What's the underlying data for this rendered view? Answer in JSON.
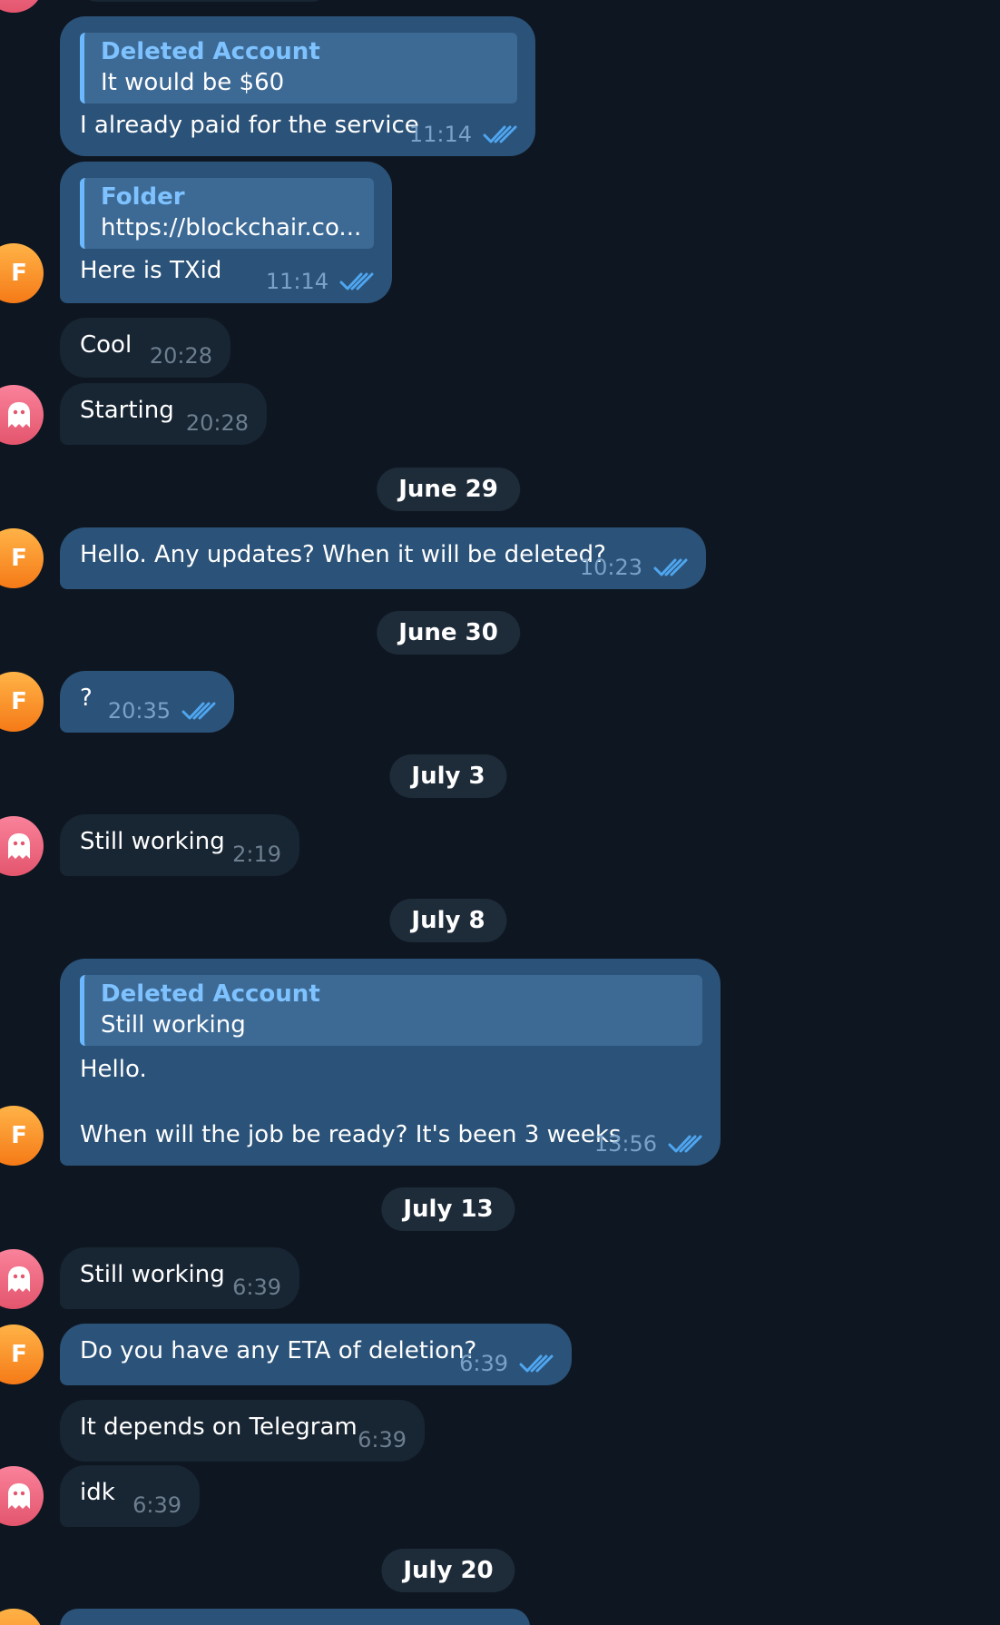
{
  "colors": {
    "background": "#0e1621",
    "outgoing_bubble": "#2b5278",
    "incoming_bubble": "#182533",
    "reply_accent": "#6cb8ff",
    "reply_author": "#7ec2ff",
    "avatar_f": "#f57a17",
    "avatar_ghost": "#e3556d",
    "read_check": "#4fa6f0"
  },
  "avatars": {
    "f_initial": "F",
    "ghost_icon": "ghost-icon"
  },
  "messages": [
    {
      "reply_author": "Deleted Account",
      "reply_text": "It would be $60",
      "text": "I already paid for the service",
      "time": "11:14"
    },
    {
      "reply_author": "Folder",
      "reply_text": "https://blockchair.co...",
      "text": "Here is TXid",
      "time": "11:14"
    },
    {
      "text": "Cool",
      "time": "20:28"
    },
    {
      "text": "Starting",
      "time": "20:28"
    },
    {
      "date": "June 29"
    },
    {
      "text": "Hello. Any updates? When it will be deleted?",
      "time": "10:23"
    },
    {
      "date": "June 30"
    },
    {
      "text": "?",
      "time": "20:35"
    },
    {
      "date": "July 3"
    },
    {
      "text": "Still working",
      "time": "2:19"
    },
    {
      "date": "July 8"
    },
    {
      "reply_author": "Deleted Account",
      "reply_text": "Still working",
      "text_line1": "Hello.",
      "text_line2": "When will the job be ready? It's been 3 weeks",
      "time": "13:56"
    },
    {
      "date": "July 13"
    },
    {
      "text": "Still working",
      "time": "6:39"
    },
    {
      "text": "Do you have any ETA of deletion?",
      "time": "6:39"
    },
    {
      "text": "It depends on Telegram",
      "time": "6:39"
    },
    {
      "text": "idk",
      "time": "6:39"
    },
    {
      "date": "July 20"
    }
  ]
}
